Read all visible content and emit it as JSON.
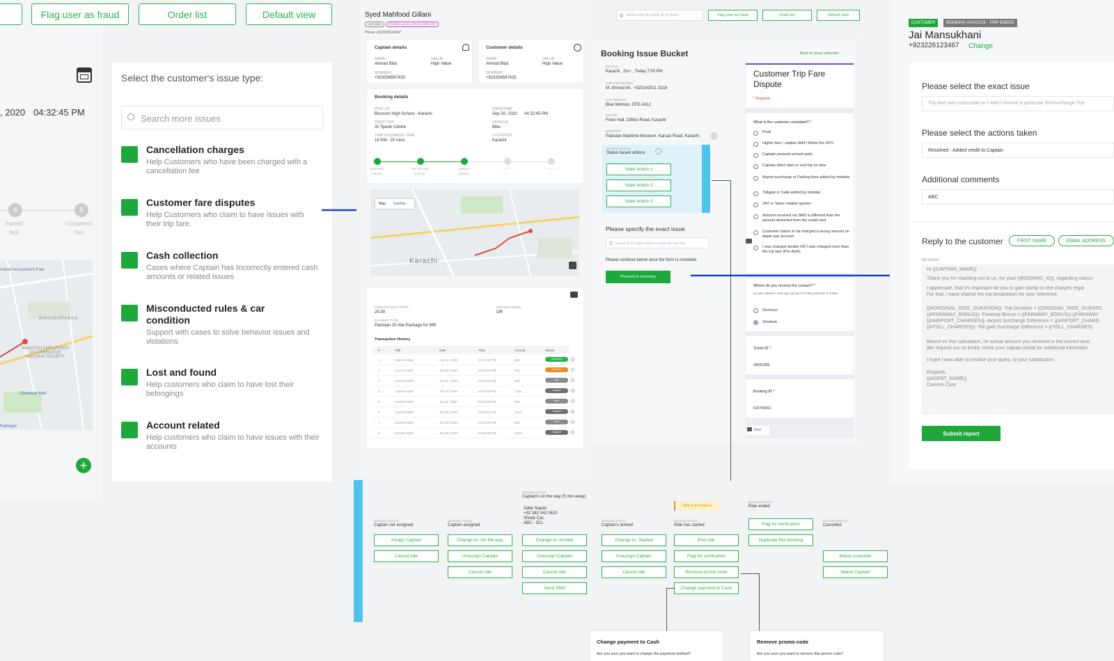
{
  "colors": {
    "green": "#1ea83c",
    "blue_arrow": "#1a3fd1",
    "cyan_bar": "#4ec4e8",
    "orange": "#f08a24",
    "grey_pill": "#7a7a7a"
  },
  "top_buttons": {
    "flag_fraud": "Flag user as fraud",
    "order_list": "Order list",
    "default_view": "Default view"
  },
  "left_panel": {
    "time": "04:32:45 PM",
    "date_partial": ", 2020",
    "steps": [
      {
        "num": "4",
        "label": "Started",
        "sub": "N/A"
      },
      {
        "num": "5",
        "label": "Completed",
        "sub": "N/A"
      }
    ],
    "map_labels": [
      "Askari Amusement Park",
      "BAHADURABAD",
      "PAKISTAN EMPLOYEES CO-OPERATIVE HOUSING SOCIETY",
      "Chanesar Halt",
      "Railways"
    ],
    "add_icon": "plus-icon"
  },
  "issue_panel": {
    "title": "Select the customer's issue type:",
    "search_placeholder": "Search more issues",
    "issues": [
      {
        "title": "Cancellation charges",
        "desc": "Help Customers who have been charged with a cancellation fee"
      },
      {
        "title": "Customer fare disputes",
        "desc": "Help Customers who claim to have issues with their trip fare."
      },
      {
        "title": "Cash collection",
        "desc": "Cases where Captain has Incorrectly entered cash amounts or related issues"
      },
      {
        "title": "Misconducted rules & car condition",
        "desc": "Support with cases to solve behavior issues and violations"
      },
      {
        "title": "Lost and found",
        "desc": "Help customers who claim to have lost their belongings"
      },
      {
        "title": "Account related",
        "desc": "Help customers who claim to have issues with their accounts"
      }
    ]
  },
  "mid_screen": {
    "customer_name": "Syed Mahfood Gillani",
    "tags": [
      "CUSTOMER",
      "BOOKING #41313 - SERVE COMPLETED"
    ],
    "phone": "Phone +923226123467",
    "search_placeholder": "Search user by email, ID or phone",
    "buttons": {
      "flag": "Flag user as fraud",
      "orders": "Order list",
      "default": "Default view"
    },
    "captain": {
      "title": "Captain details",
      "name_lbl": "Name",
      "name": "Ahmad Bilal",
      "value_lbl": "Value",
      "value": "High Value",
      "num_lbl": "Number",
      "num": "+923334587433"
    },
    "customer": {
      "title": "Customer details",
      "name_lbl": "Name",
      "name": "Ahmad Bilal",
      "value_lbl": "Value",
      "value": "High Value",
      "num_lbl": "Number",
      "num": "+923334587433"
    },
    "booking": {
      "title": "Booking details",
      "pickup_lbl": "Pick up",
      "pickup": "Blossom High School - Karachi",
      "date_lbl": "Date/Time",
      "date": "Sep 20, 2020",
      "time": "04:32:45 PM",
      "drop_lbl": "Drop off",
      "drop": "Al-Tijarah Centre",
      "vehicle_lbl": "Vehicle",
      "vehicle": "Bike",
      "distance_lbl": "Trip distance/ time",
      "distance": "16 KM - 20 mins",
      "location_lbl": "Location",
      "location": "Karachi",
      "steps": [
        {
          "label": "Assigned",
          "time": "9:38 AM"
        },
        {
          "label": "On the way",
          "time": "9:34 AM"
        },
        {
          "label": "Arrived",
          "time": "9:38 AM"
        },
        {
          "label": "Started",
          "time": "N/A"
        },
        {
          "label": "Completed",
          "time": "N/A"
        }
      ]
    },
    "map_tabs": [
      "Map",
      "Satellite"
    ],
    "map_city": "Karachi",
    "fare": {
      "estimate_lbl": "Fare Estimate (PKR)",
      "estimate": "25.09",
      "pricing_lbl": "Pricing Model",
      "pricing": "OR",
      "payment_lbl": "Payment Type",
      "payment": "Pakistan 20 ride Package for 999",
      "history_title": "Transaction History",
      "columns": [
        "#",
        "Title",
        "Date",
        "Time",
        "Amount",
        "Status"
      ],
      "rows": [
        {
          "n": "1",
          "t": "Careem Ride",
          "d": "Jan 24, 2020",
          "tm": "04:52:23 PM",
          "a": "200",
          "s": "Received",
          "c": "#2bb24c"
        },
        {
          "n": "2",
          "t": "Careem Ride",
          "d": "Jan 18, 2020",
          "tm": "04:52:23 PM",
          "a": "235",
          "s": "On hold",
          "c": "#f08a24"
        },
        {
          "n": "3",
          "t": "Careem Ride",
          "d": "Jan 11, 2020",
          "tm": "04:52:23 PM",
          "a": "400",
          "s": "Void",
          "c": "#8a8a8a"
        },
        {
          "n": "4",
          "t": "Careem Ride",
          "d": "Jan 10, 2020",
          "tm": "04:52:23 PM",
          "a": "1236",
          "s": "Capture",
          "c": "#6f6f6f"
        },
        {
          "n": "5",
          "t": "Careem Ride",
          "d": "Jan 11, 2020",
          "tm": "04:52:23 PM",
          "a": "595",
          "s": "Void",
          "c": "#8a8a8a"
        },
        {
          "n": "6",
          "t": "Careem Ride",
          "d": "Jan 08, 2020",
          "tm": "04:52:23 PM",
          "a": "1234",
          "s": "Capture",
          "c": "#6f6f6f"
        },
        {
          "n": "7",
          "t": "Careem Ride",
          "d": "Jan 08, 2020",
          "tm": "04:52:23 PM",
          "a": "600",
          "s": "Void",
          "c": "#8a8a8a"
        },
        {
          "n": "8",
          "t": "Careem Ride",
          "d": "Jan 06, 2020",
          "tm": "04:52:23 PM",
          "a": "1234",
          "s": "Capture",
          "c": "#6f6f6f"
        }
      ]
    }
  },
  "bucket": {
    "title": "Booking Issue Bucket",
    "back_link": "Back to issue selection",
    "details_lbl": "Details",
    "details": "Karachi , Go+ , Today 7:00 PM",
    "captain_lbl": "Captain details",
    "captain": "M. Ahmed Ali . +923142511 3214",
    "car_lbl": "Car details",
    "car": "Blue Mehran, CFE-2412",
    "pickup_lbl": "Pickup",
    "pickup": "Frere Hall, Clifton Road, Karachi",
    "dropoff_lbl": "Dropoff",
    "dropoff": "Pakistan Maritime Museum, Karsaz Road, Karachi",
    "status_lbl": "Booking status",
    "status_actions": "Status based actions",
    "state_buttons": [
      "State button 1",
      "State button 2",
      "State button 3"
    ],
    "exact_title": "Please specify the exact issue",
    "exact_placeholder": "Search for the right problem to assist the user with",
    "continue_text": "Please continue below once the form is complete",
    "proceed": "Proceed to summary"
  },
  "form": {
    "title": "Customer Trip Fare Dispute",
    "required": "* Required",
    "q1": "What is the customer complaint? *",
    "options": [
      "Peak",
      "Higher fare / captain didn't follow the GPS",
      "Captain pressed arrived early",
      "Captain didn't start or end trip on time",
      "Airport surcharge or Parking fees added by mistake",
      "Tollgate or Salik added by mistake",
      "VAT or Taxes related queries",
      "Amount received via SMS is different than the amount deducted from the credit card",
      "Customer claims to be charged a wrong amount on Apple pay account",
      "I was charged double OR I was charged more than the trip fare (Pre-Auth)"
    ],
    "q2": "Where do you receive the contact? *",
    "q2_note": "DO NOT MODIFY. THIS WILL BE AUTO-POPULATED BY SYSTEM.",
    "contacts": [
      "Genesys",
      "Zendesk"
    ],
    "ticket_lbl": "Ticket ID *",
    "ticket": "34681685t",
    "booking_lbl": "Booking ID *",
    "booking": "919745463",
    "next": "Next"
  },
  "right_panel": {
    "tags": [
      "CUSTOMER",
      "BOOKING #2413123 - TRIP ENDED"
    ],
    "name": "Jai Mansukhani",
    "phone": "+923226123467",
    "change": "Change",
    "exact_lbl": "Please select the exact issue",
    "exact_val": "Trip fare was inaccurate or I didn't receive a particular fee/surcharge   Trip",
    "actions_lbl": "Please select the actions taken",
    "actions_val": "Resolved - Added credit to Captain",
    "comments_lbl": "Additional comments",
    "comments_val": "ABC",
    "reply_lbl": "Reply to the customer",
    "chips": [
      "FIRST NAME",
      "EMAIL ADDRESS"
    ],
    "message_lbl": "MESSAGE",
    "message": [
      "Hi {{CAPTAIN_NAME}}",
      "Thank you for reaching out to us, for your {{BOOKING_ID}}, regarding inaccu",
      "I appreciate, that it's important for you to gain clarity on the charges regar",
      "For that, I have shared the trip breakdown for your reference.",
      "{{#ORIGINAL_RIDE_DURATION}}- Trip Duration = {{ORIGINAL_RIDE_DURATIC",
      "{{#FARAWAY_BONUS}}- Faraway Bonus = {{FARAWAY_BONUS}} {{FARAWAY",
      "{{#AIRPORT_CHARGES}}- Airport Surcharge Difference = {{AIRPORT_CHARG",
      "{{#TOLL_CHARGES}}- Toll gate Surcharge Difference = {{TOLL_CHARGES}",
      "Based on this calculation, he actual amount you received is the correct amo",
      "We request you to kindly check your captain portal for additional informatio",
      "I hope I was able to resolve your query, to your satisfaction.",
      "Regards,",
      "{{AGENT_NAME}}",
      "Careem Care"
    ],
    "submit": "Submit report"
  },
  "status_flow": {
    "columns": [
      {
        "lbl": "Booking status",
        "val": "Captain not assigned",
        "buttons": [
          "Assign Captain",
          "Cancel ride"
        ]
      },
      {
        "lbl": "Booking status",
        "val": "Captain assigned",
        "buttons": [
          "Change to: On the way",
          "Unassign Captain",
          "Cancel ride"
        ]
      },
      {
        "lbl": "Booking status",
        "val": "Captain's on the way (5 min away)",
        "buttons": [
          "Change to: Arrived",
          "Unassign Captain",
          "Cancel ride",
          "Send SMS"
        ]
      },
      {
        "lbl": "Booking status",
        "val": "Captain's arrived",
        "buttons": [
          "Change to: Started",
          "Unassign Captain",
          "Cancel ride"
        ]
      },
      {
        "lbl": "Booking status",
        "val": "Ride has started",
        "buttons": [
          "End ride",
          "Flag for verification",
          "Remove promo code",
          "Change payment to Cash"
        ]
      },
      {
        "lbl": "Booking status",
        "val": "Ride ended",
        "buttons": [
          "Flag for verification",
          "Duplicate this booking"
        ]
      },
      {
        "lbl": "Booking status",
        "val": "Cancelled",
        "buttons": [
          "Waive customer",
          "Waive Captain"
        ]
      }
    ],
    "captain_info": [
      "Zafar Supari",
      "+92 342 042 0420",
      "Shedy Car,",
      "ABC - 321"
    ],
    "in_progress": "Ride is in progress",
    "dialogs": [
      {
        "title": "Change payment to Cash",
        "text": "Are you sure you want to change the payment method?"
      },
      {
        "title": "Remove promo code",
        "text": "Are you sure you want to remove this promo code?"
      }
    ]
  }
}
